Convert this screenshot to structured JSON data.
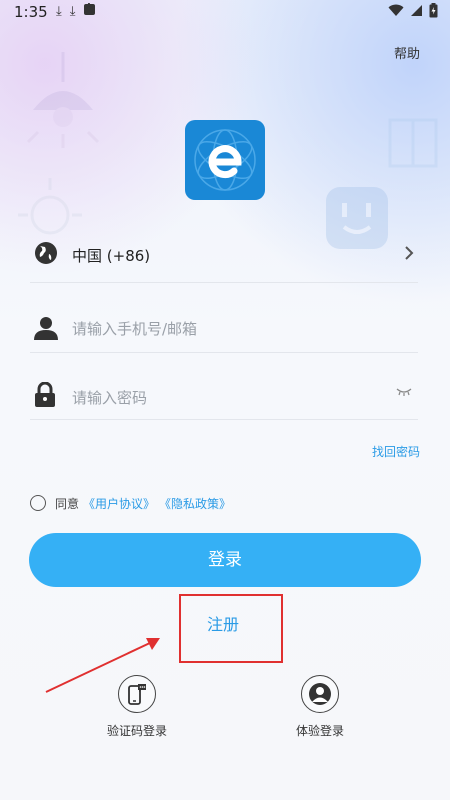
{
  "status_bar": {
    "time": "1:35",
    "download_icon_1": "⤓",
    "download_icon_2": "⤓",
    "a_icon": "A"
  },
  "header": {
    "help_label": "帮助"
  },
  "country": {
    "value": "中国 (+86)"
  },
  "phone": {
    "placeholder": "请输入手机号/邮箱"
  },
  "password": {
    "placeholder": "请输入密码"
  },
  "forgot_password_label": "找回密码",
  "agreement": {
    "prefix": "同意",
    "user_agreement": "《用户协议》",
    "privacy_policy": "《隐私政策》"
  },
  "login_button_label": "登录",
  "register_label": "注册",
  "alt_logins": [
    {
      "label": "验证码登录",
      "icon": "sms-phone-icon"
    },
    {
      "label": "体验登录",
      "icon": "user-icon"
    }
  ],
  "colors": {
    "accent": "#35b0f5",
    "link": "#2a9be6",
    "logo_bg": "#1a88d6",
    "highlight": "#e03030"
  }
}
